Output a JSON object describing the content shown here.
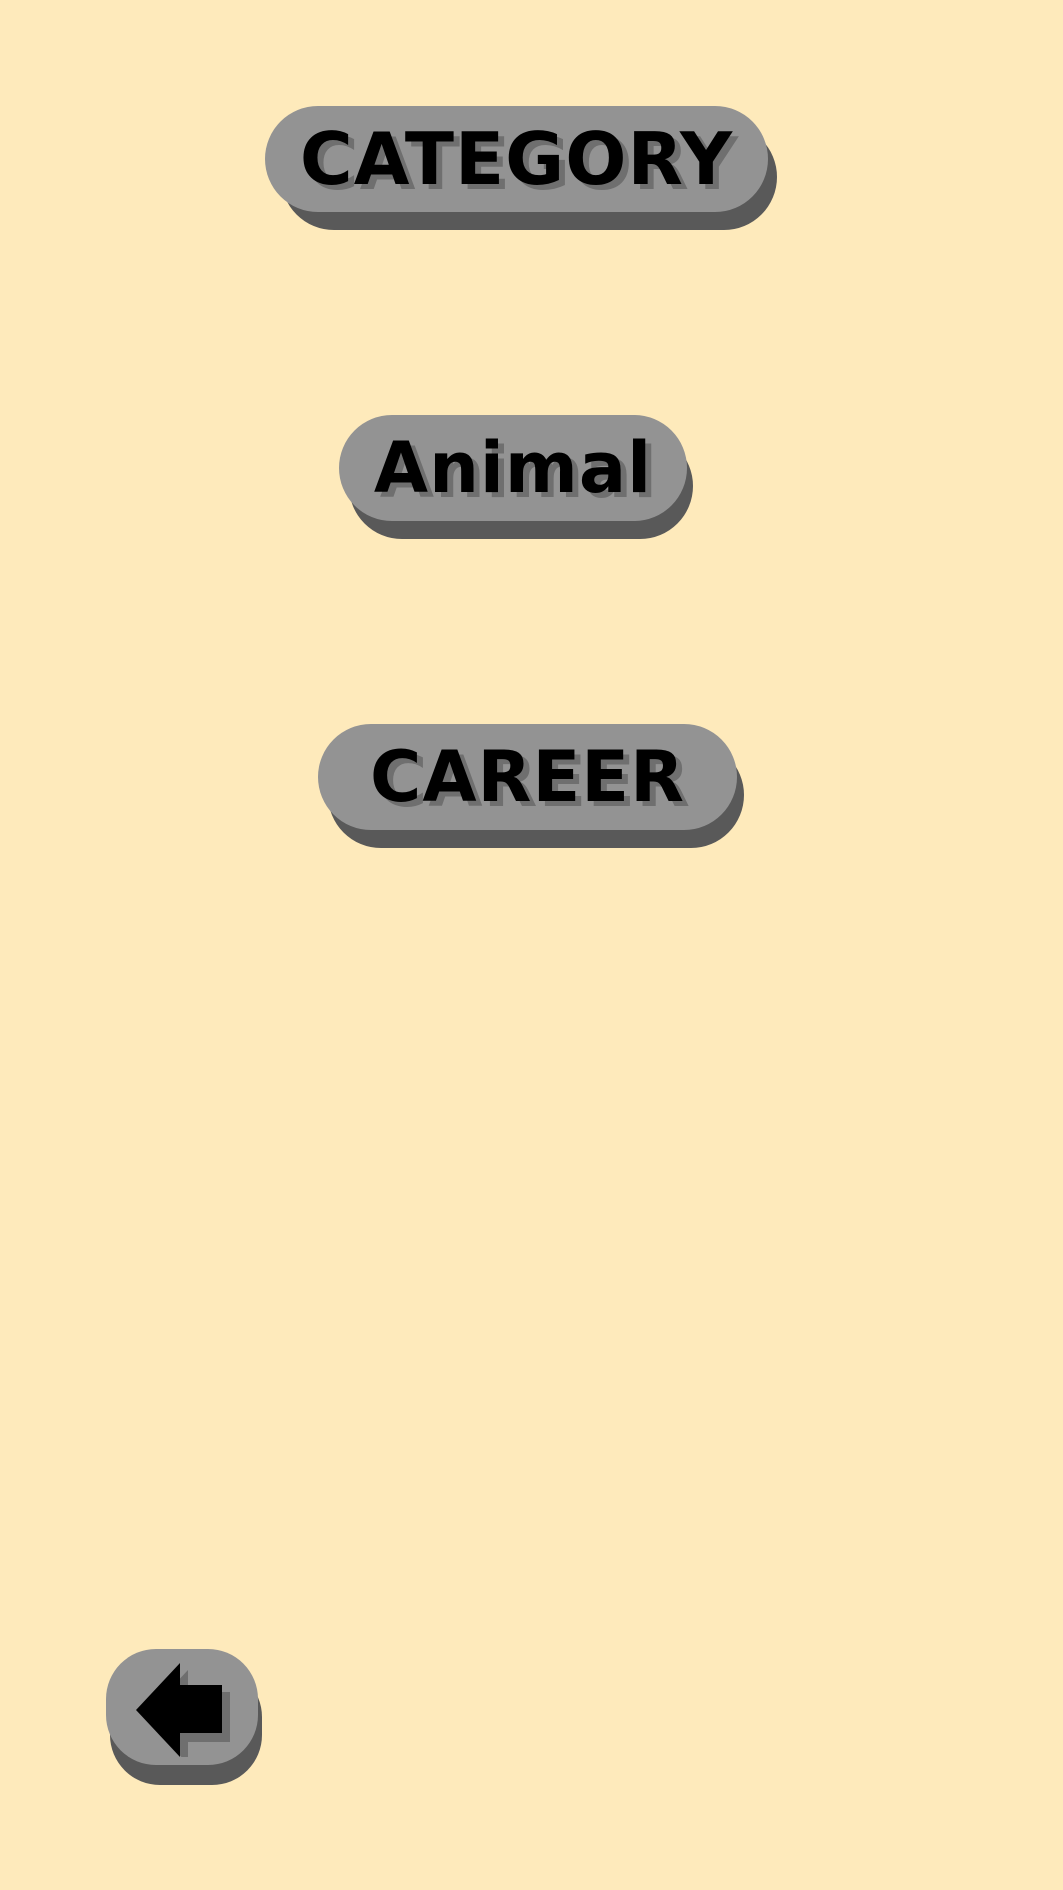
{
  "screen": {
    "background_color": "#FEEABB",
    "button_face_color": "#939393",
    "button_shadow_color": "#595959"
  },
  "header": {
    "title": "CATEGORY"
  },
  "categories": [
    {
      "label": "Animal"
    },
    {
      "label": "CAREER"
    }
  ],
  "footer": {
    "back_icon": "back-arrow-icon"
  }
}
